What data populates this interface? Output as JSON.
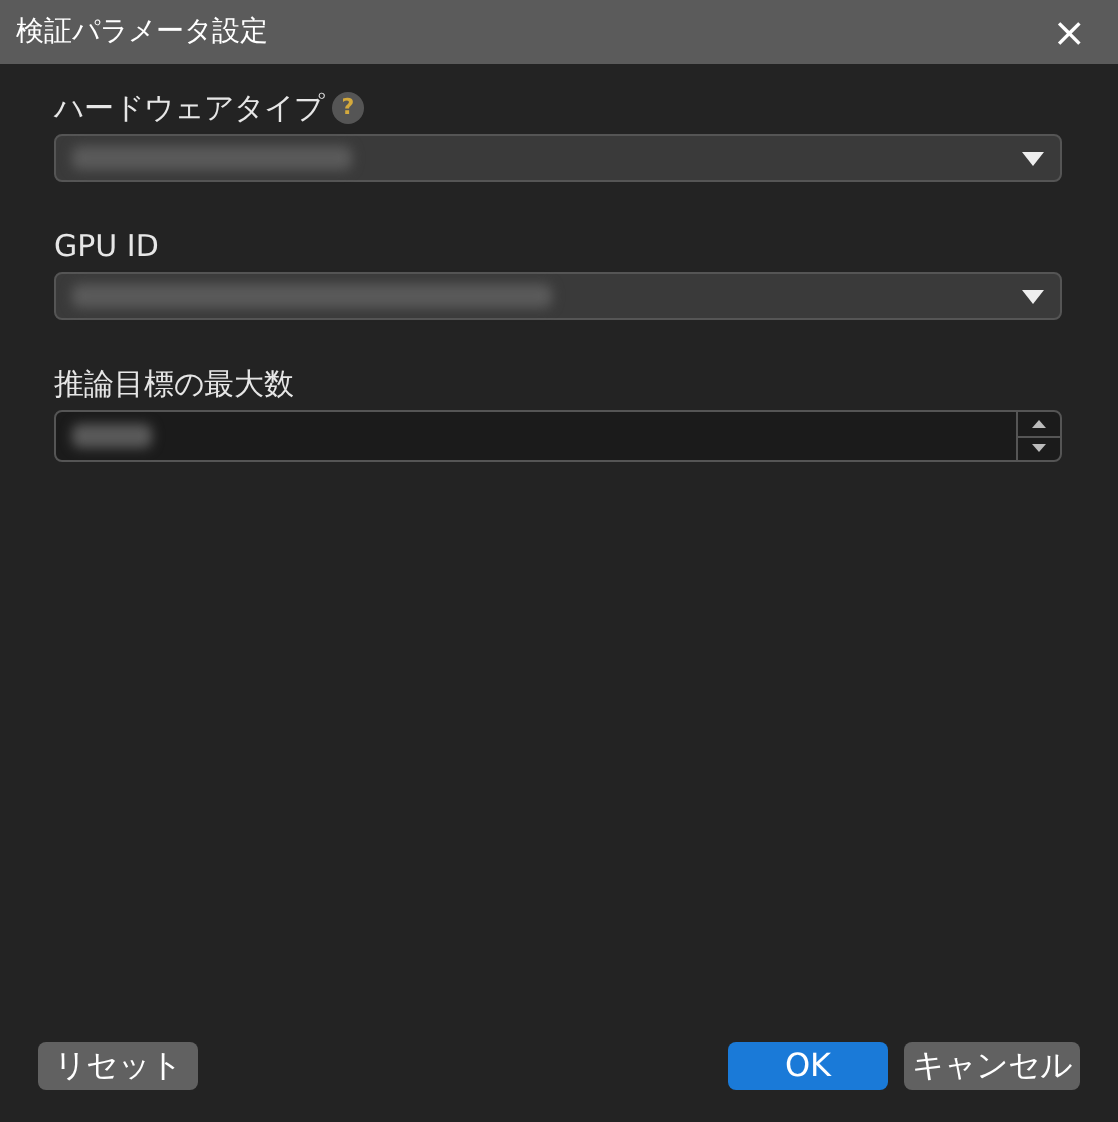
{
  "window": {
    "title": "検証パラメータ設定",
    "close": "×"
  },
  "fields": [
    {
      "kind": "select",
      "label": "ハードウェアタイプ",
      "help": "?"
    },
    {
      "kind": "select",
      "label": "GPU ID"
    },
    {
      "kind": "number",
      "label": "推論目標の最大数"
    }
  ],
  "buttons": [
    {
      "label": "リセット",
      "kind": "secondary"
    },
    {
      "label": "OK",
      "kind": "primary"
    },
    {
      "label": "キャンセル",
      "kind": "secondary"
    }
  ]
}
